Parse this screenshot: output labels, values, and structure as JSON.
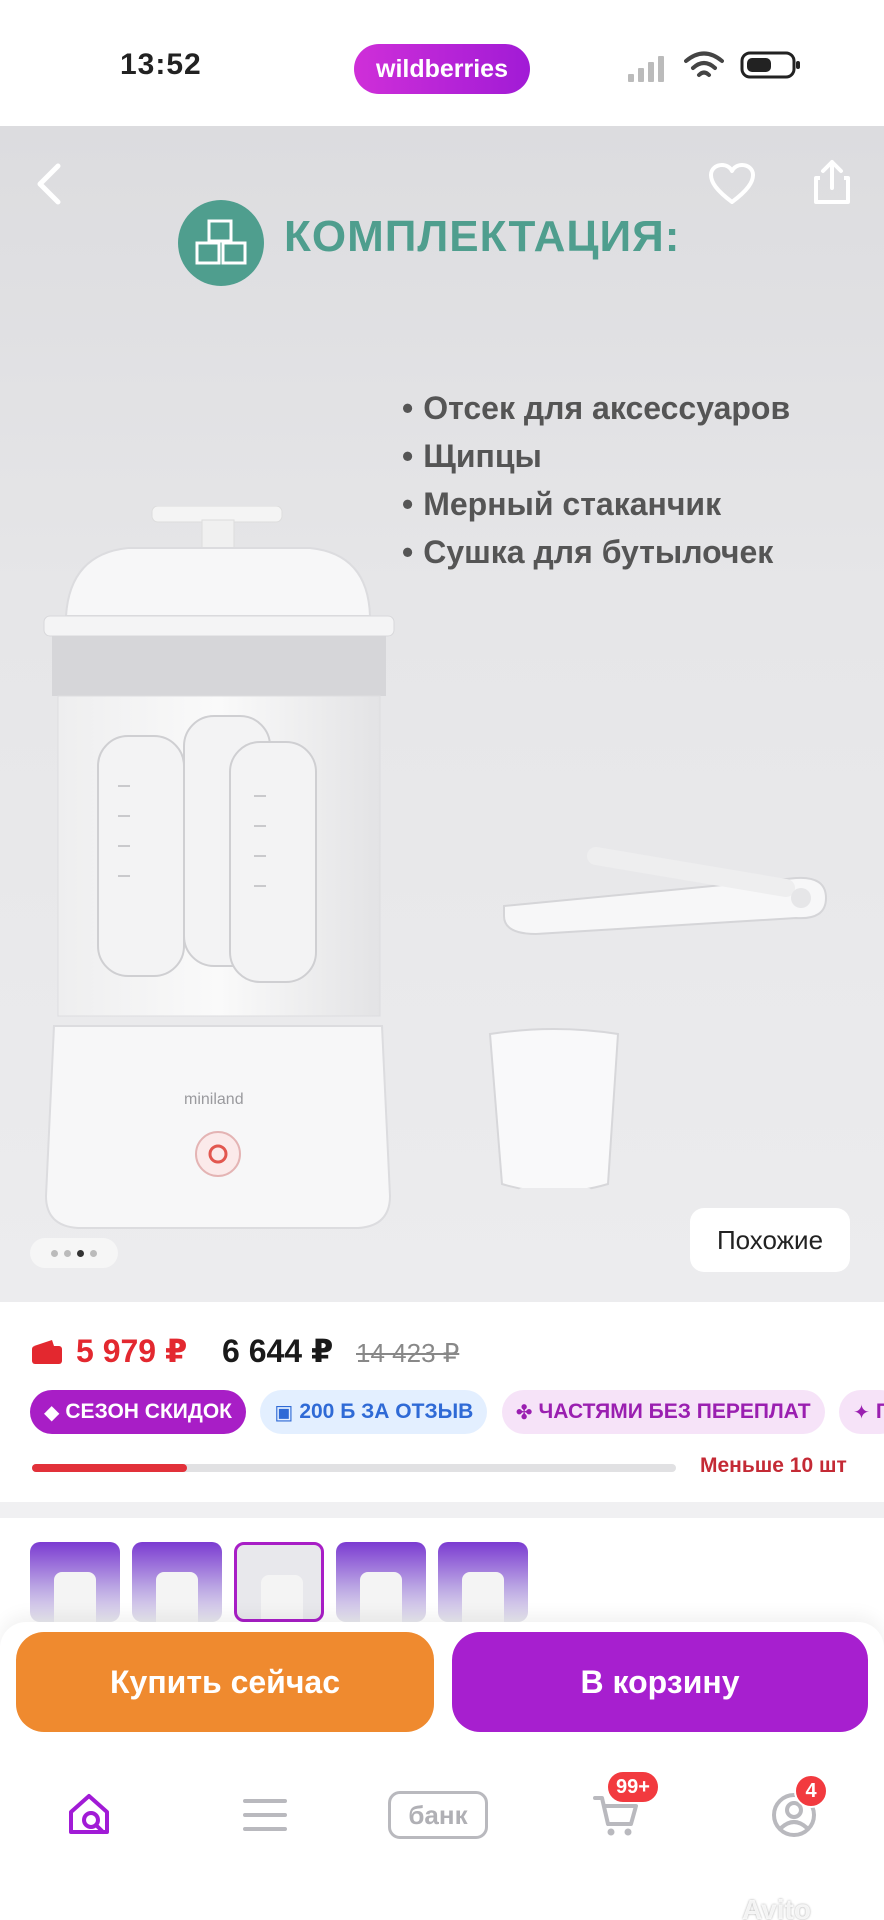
{
  "status_bar": {
    "time": "13:52",
    "brand": "wildberries"
  },
  "hero": {
    "heading": "КОМПЛЕКТАЦИЯ:",
    "features": [
      "Отсек для аксессуаров",
      "Щипцы",
      "Мерный стаканчик",
      "Сушка для бутылочек"
    ],
    "product_brand": "miniland",
    "similar_label": "Похожие",
    "carousel_total": 4,
    "carousel_active": 3
  },
  "price": {
    "wallet_price": "5 979 ₽",
    "price": "6 644 ₽",
    "old_price": "14 423 ₽"
  },
  "badges": {
    "season": "СЕЗОН СКИДОК",
    "review": "200 Б ЗА ОТЗЫВ",
    "installments": "ЧАСТЯМИ БЕЗ ПЕРЕПЛАТ",
    "more": "Г"
  },
  "stock": {
    "label": "Меньше 10 шт",
    "level": 0.24
  },
  "actions": {
    "buy_now": "Купить сейчас",
    "add_to_cart": "В корзину"
  },
  "tabbar": {
    "bank_label": "банк",
    "cart_count": "99+",
    "profile_count": "4"
  },
  "watermark": "Avito",
  "colors": {
    "brand_purple": "#a71fcf",
    "buy_orange": "#ef8a2f",
    "price_red": "#e3282f",
    "heading_teal": "#4f9e8e"
  },
  "icons": [
    "back-arrow-icon",
    "heart-icon",
    "share-icon",
    "cubes-icon",
    "wallet-icon",
    "search-home-icon",
    "menu-icon",
    "cart-icon",
    "profile-icon"
  ]
}
